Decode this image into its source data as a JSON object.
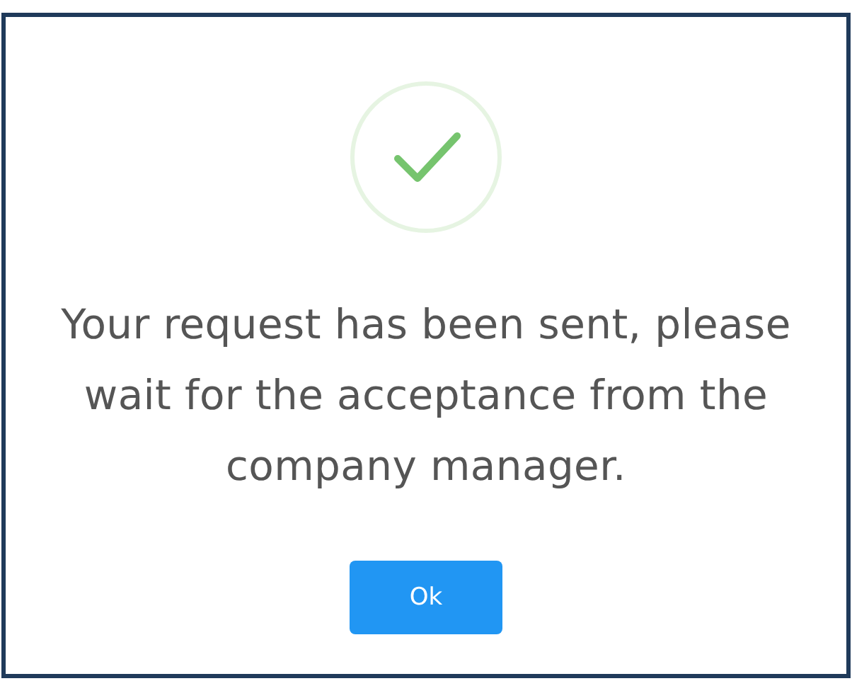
{
  "dialog": {
    "message": "Your request has been sent, please wait for the acceptance from the company manager.",
    "button": "Ok"
  }
}
